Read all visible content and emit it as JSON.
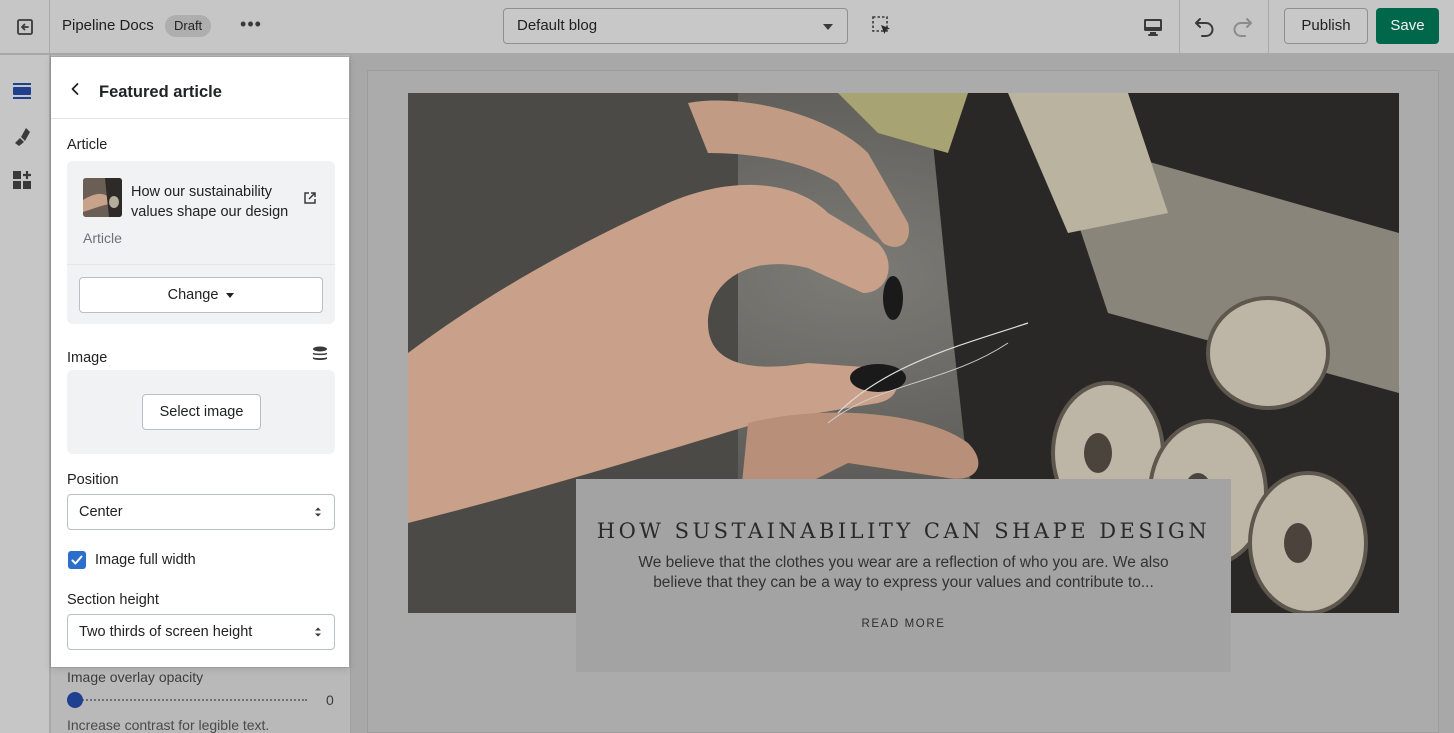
{
  "topbar": {
    "exit_icon": "exit-icon",
    "store_name": "Pipeline Docs",
    "status_badge": "Draft",
    "more_label": "•••",
    "template_select": "Default blog",
    "publish_label": "Publish",
    "save_label": "Save",
    "save_color": "#00674a"
  },
  "rail": {
    "items": [
      {
        "icon": "sections-icon"
      },
      {
        "icon": "theme-settings-icon"
      },
      {
        "icon": "app-blocks-icon"
      }
    ]
  },
  "underlying_panel": {
    "overlay_label": "Image overlay opacity",
    "overlay_value": "0",
    "overlay_help": "Increase contrast for legible text."
  },
  "popover": {
    "title": "Featured article",
    "article_label": "Article",
    "article_name": "How our sustainability values shape our design",
    "article_type": "Article",
    "change_label": "Change",
    "image_label": "Image",
    "select_image_label": "Select image",
    "position_label": "Position",
    "position_value": "Center",
    "full_width_label": "Image full width",
    "full_width_checked": true,
    "section_height_label": "Section height",
    "section_height_value": "Two thirds of screen height",
    "accent_color": "#2c6ecb"
  },
  "preview": {
    "card_title": "HOW SUSTAINABILITY CAN SHAPE DESIGN",
    "card_body": "We believe that the clothes you wear are a reflection of who you are. We also believe that they can be a way to express your values and contribute to...",
    "card_link": "READ MORE"
  }
}
